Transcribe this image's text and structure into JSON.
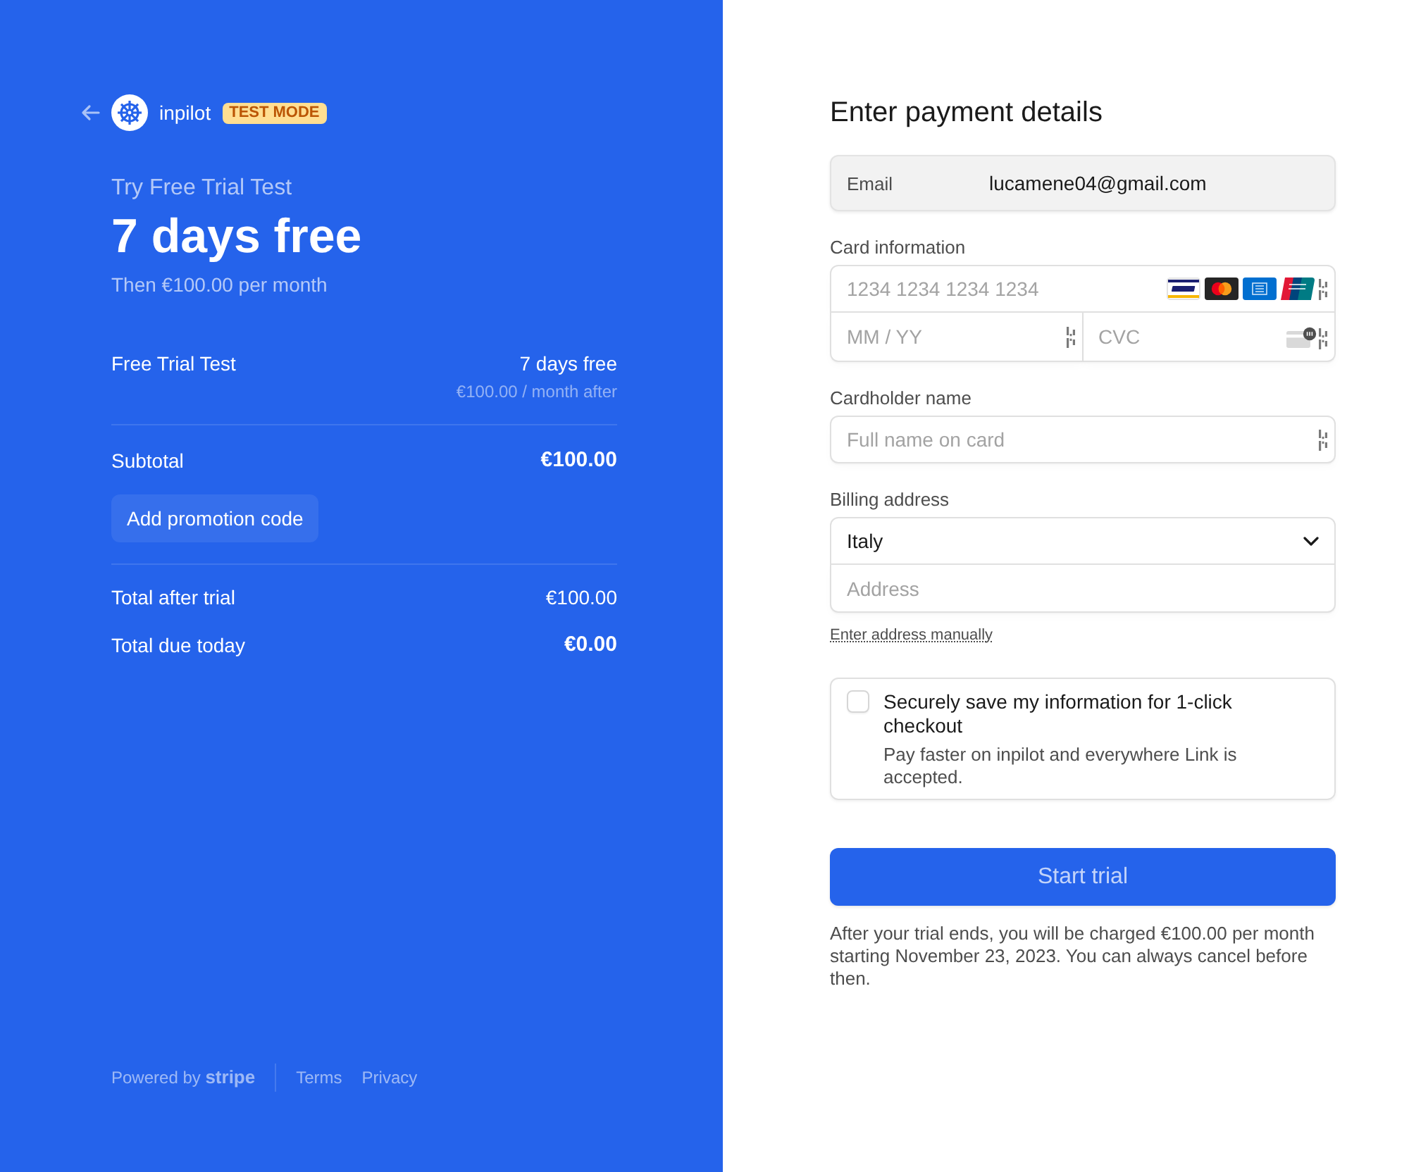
{
  "header": {
    "brand": "inpilot",
    "badge": "TEST MODE"
  },
  "summary": {
    "product": "Try Free Trial Test",
    "price": "7 days free",
    "recurring": "Then €100.00 per month"
  },
  "line_items": [
    {
      "name": "Free Trial Test",
      "amount": "7 days free",
      "detail": "€100.00 / month after"
    }
  ],
  "subtotal": {
    "label": "Subtotal",
    "amount": "€100.00"
  },
  "promotion_button": "Add promotion code",
  "totals": [
    {
      "label": "Total after trial",
      "amount": "€100.00",
      "emphasis": false
    },
    {
      "label": "Total due today",
      "amount": "€0.00",
      "emphasis": true
    }
  ],
  "footer": {
    "powered_by": "Powered by **stripe**",
    "links": [
      "Terms",
      "Privacy"
    ]
  },
  "form": {
    "title": "Enter payment details",
    "email": {
      "label": "Email",
      "value": "lucamene04@gmail.com"
    },
    "card": {
      "label": "Card information",
      "number_placeholder": "1234 1234 1234 1234",
      "expiry_placeholder": "MM / YY",
      "cvc_placeholder": "CVC"
    },
    "cardholder": {
      "label": "Cardholder name",
      "placeholder": "Full name on card"
    },
    "billing": {
      "label": "Billing address",
      "country": "Italy",
      "address_placeholder": "Address",
      "manual_link": "Enter address manually"
    },
    "save_info": {
      "checked": false,
      "title": "Securely save my information for 1-click checkout",
      "description": "Pay faster on inpilot and everywhere Link is accepted."
    },
    "submit": "Start trial",
    "disclaimer": "After your trial ends, you will be charged €100.00 per month starting November 23, 2023. You can always cancel before then."
  }
}
